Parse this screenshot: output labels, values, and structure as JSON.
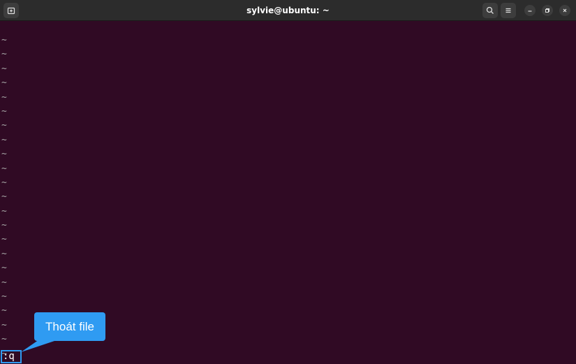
{
  "window": {
    "title": "sylvie@ubuntu: ~"
  },
  "editor": {
    "empty_line_marker": "~",
    "empty_line_count": 23,
    "command": ":q"
  },
  "annotation": {
    "label": "Thoát file",
    "color": "#2f9bf2"
  },
  "icons": {
    "new_tab": "new-tab-icon",
    "search": "search-icon",
    "menu": "hamburger-menu-icon",
    "minimize": "minimize-icon",
    "maximize": "maximize-icon",
    "close": "close-icon"
  }
}
